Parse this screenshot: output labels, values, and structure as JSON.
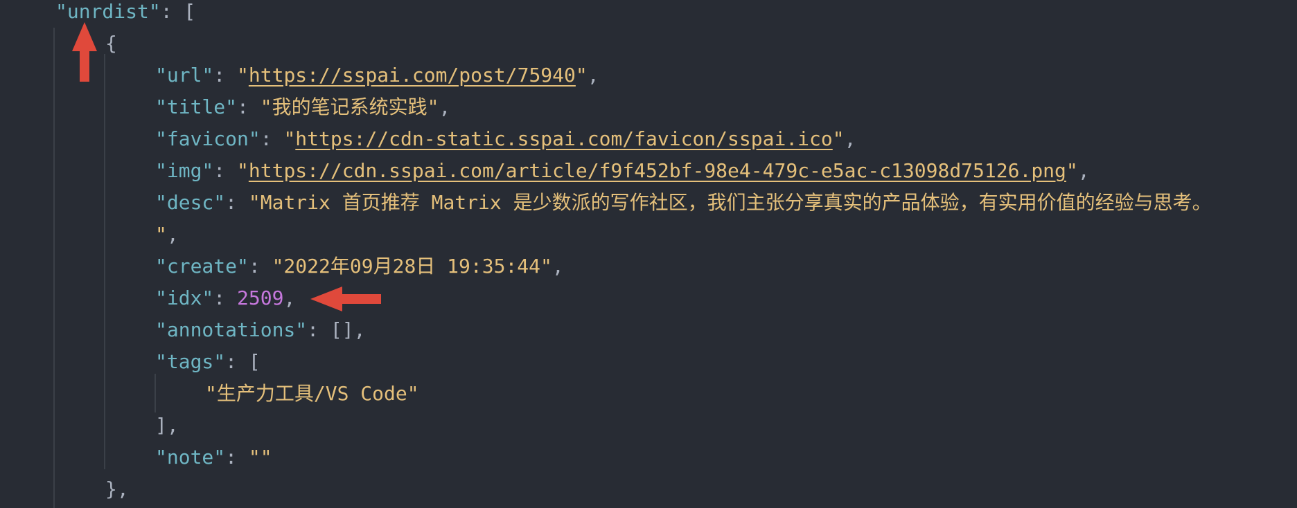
{
  "editor": {
    "colors": {
      "background": "#282c34",
      "key": "#6fb6c4",
      "string": "#e5c07b",
      "number": "#c678dd",
      "punctuation": "#abb2bf",
      "arrow": "#e0493b"
    },
    "lines": [
      {
        "indent": 0,
        "tokens": [
          {
            "type": "key",
            "text": "\"unrdist\""
          },
          {
            "type": "punct",
            "text": ": ["
          }
        ]
      },
      {
        "indent": 1,
        "tokens": [
          {
            "type": "punct",
            "text": "{"
          }
        ]
      },
      {
        "indent": 2,
        "tokens": [
          {
            "type": "key",
            "text": "\"url\""
          },
          {
            "type": "punct",
            "text": ": "
          },
          {
            "type": "string",
            "text": "\""
          },
          {
            "type": "link",
            "text": "https://sspai.com/post/75940"
          },
          {
            "type": "string",
            "text": "\""
          },
          {
            "type": "punct",
            "text": ","
          }
        ]
      },
      {
        "indent": 2,
        "tokens": [
          {
            "type": "key",
            "text": "\"title\""
          },
          {
            "type": "punct",
            "text": ": "
          },
          {
            "type": "string",
            "text": "\"我的笔记系统实践\""
          },
          {
            "type": "punct",
            "text": ","
          }
        ]
      },
      {
        "indent": 2,
        "tokens": [
          {
            "type": "key",
            "text": "\"favicon\""
          },
          {
            "type": "punct",
            "text": ": "
          },
          {
            "type": "string",
            "text": "\""
          },
          {
            "type": "link",
            "text": "https://cdn-static.sspai.com/favicon/sspai.ico"
          },
          {
            "type": "string",
            "text": "\""
          },
          {
            "type": "punct",
            "text": ","
          }
        ]
      },
      {
        "indent": 2,
        "tokens": [
          {
            "type": "key",
            "text": "\"img\""
          },
          {
            "type": "punct",
            "text": ": "
          },
          {
            "type": "string",
            "text": "\""
          },
          {
            "type": "link",
            "text": "https://cdn.sspai.com/article/f9f452bf-98e4-479c-e5ac-c13098d75126.png"
          },
          {
            "type": "string",
            "text": "\""
          },
          {
            "type": "punct",
            "text": ","
          }
        ]
      },
      {
        "indent": 2,
        "tokens": [
          {
            "type": "key",
            "text": "\"desc\""
          },
          {
            "type": "punct",
            "text": ": "
          },
          {
            "type": "string",
            "text": "\"Matrix 首页推荐 Matrix 是少数派的写作社区，我们主张分享真实的产品体验，有实用价值的经验与思考。"
          }
        ]
      },
      {
        "indent": 2,
        "tokens": [
          {
            "type": "string",
            "text": "\""
          },
          {
            "type": "punct",
            "text": ","
          }
        ]
      },
      {
        "indent": 2,
        "tokens": [
          {
            "type": "key",
            "text": "\"create\""
          },
          {
            "type": "punct",
            "text": ": "
          },
          {
            "type": "string",
            "text": "\"2022年09月28日 19:35:44\""
          },
          {
            "type": "punct",
            "text": ","
          }
        ]
      },
      {
        "indent": 2,
        "tokens": [
          {
            "type": "key",
            "text": "\"idx\""
          },
          {
            "type": "punct",
            "text": ": "
          },
          {
            "type": "number",
            "text": "2509"
          },
          {
            "type": "punct",
            "text": ","
          }
        ]
      },
      {
        "indent": 2,
        "tokens": [
          {
            "type": "key",
            "text": "\"annotations\""
          },
          {
            "type": "punct",
            "text": ": [],"
          }
        ]
      },
      {
        "indent": 2,
        "tokens": [
          {
            "type": "key",
            "text": "\"tags\""
          },
          {
            "type": "punct",
            "text": ": ["
          }
        ]
      },
      {
        "indent": 3,
        "tokens": [
          {
            "type": "string",
            "text": "\"生产力工具/VS Code\""
          }
        ]
      },
      {
        "indent": 2,
        "tokens": [
          {
            "type": "punct",
            "text": "],"
          }
        ]
      },
      {
        "indent": 2,
        "tokens": [
          {
            "type": "key",
            "text": "\"note\""
          },
          {
            "type": "punct",
            "text": ": "
          },
          {
            "type": "string",
            "text": "\"\""
          }
        ]
      },
      {
        "indent": 1,
        "tokens": [
          {
            "type": "punct",
            "text": "},"
          }
        ]
      }
    ]
  },
  "annotations": {
    "arrow_up": {
      "icon": "arrow-up-icon",
      "target": "unrdist"
    },
    "arrow_left": {
      "icon": "arrow-left-icon",
      "target": "idx"
    }
  }
}
